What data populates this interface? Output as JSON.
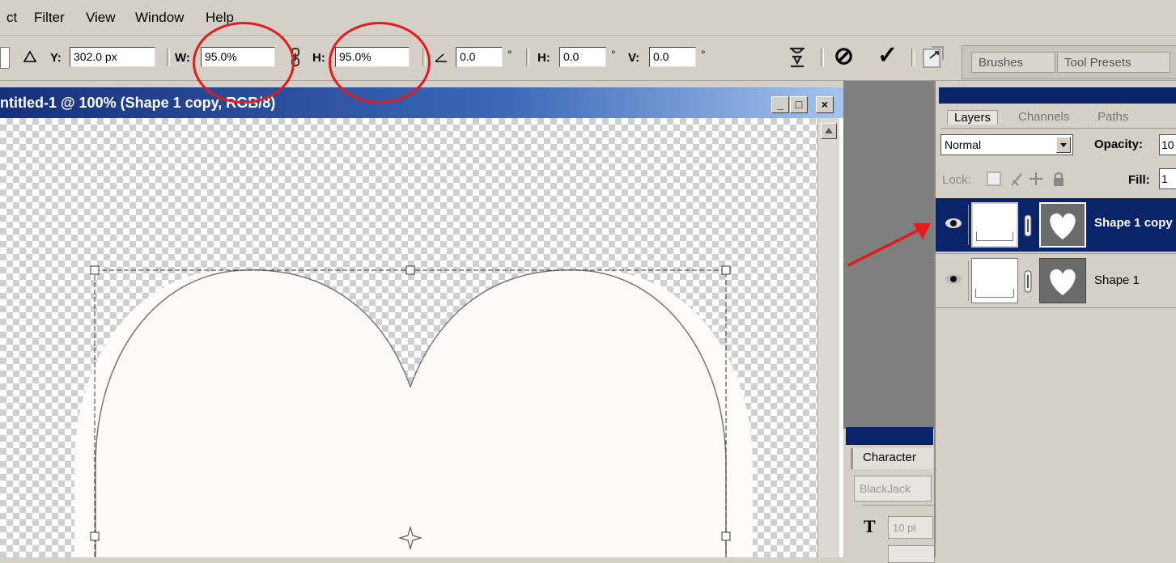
{
  "menu": [
    "ct",
    "Filter",
    "View",
    "Window",
    "Help"
  ],
  "options_bar": {
    "y_label": "Y:",
    "y_value": "302.0 px",
    "w_label": "W:",
    "w_value": "95.0%",
    "h_label": "H:",
    "h_value": "95.0%",
    "angle_value": "0.0",
    "angle_unit": "°",
    "hskew_label": "H:",
    "hskew_value": "0.0",
    "hskew_unit": "°",
    "vskew_label": "V:",
    "vskew_value": "0.0",
    "vskew_unit": "°",
    "cancel_symbol": "⊘",
    "commit_symbol": "✓",
    "brushes_tab": "Brushes",
    "tool_presets_tab": "Tool Presets"
  },
  "document": {
    "title": "ntitled-1 @ 100% (Shape 1 copy, RGB/8)",
    "minimize": "_",
    "maximize": "□",
    "close": "×"
  },
  "character_panel": {
    "tab": "Character",
    "font": "BlackJack",
    "size_icon": "T",
    "size": "10 pt"
  },
  "layers_panel": {
    "tabs": [
      "Layers",
      "Channels",
      "Paths"
    ],
    "blend_mode": "Normal",
    "opacity_label": "Opacity:",
    "opacity_value": "10",
    "lock_label": "Lock:",
    "fill_label": "Fill:",
    "fill_value": "1",
    "layers": [
      {
        "name": "Shape 1 copy",
        "selected": true
      },
      {
        "name": "Shape 1",
        "selected": false
      }
    ]
  },
  "colors": {
    "annotation_red": "#e21b1b",
    "selected_layer": "#0a246a",
    "title_bar": "#16307a"
  }
}
